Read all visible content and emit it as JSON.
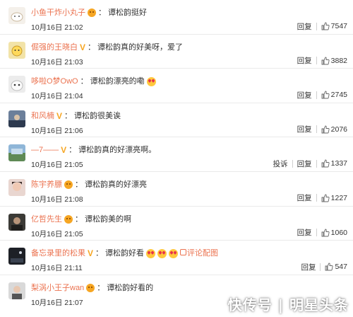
{
  "comments": [
    {
      "user": "小鱼干炸小丸子",
      "colon": "：",
      "text": "谭松韵挺好",
      "time": "10月16日 21:02",
      "reply": "回复",
      "likes": "7547"
    },
    {
      "user": "倔强的王晓白",
      "colon": "：",
      "text": "谭松韵真的好美呀，爱了",
      "time": "10月16日 21:03",
      "reply": "回复",
      "likes": "3882"
    },
    {
      "user": "哆啦O梦OwO",
      "colon": "：",
      "text": "谭松韵漂亮的嘞",
      "time": "10月16日 21:04",
      "reply": "回复",
      "likes": "2745"
    },
    {
      "user": "和风楠",
      "colon": "：",
      "text": "谭松韵很美诶",
      "time": "10月16日 21:06",
      "reply": "回复",
      "likes": "2076"
    },
    {
      "user": "—7——",
      "colon": "：",
      "text": "谭松韵真的好漂亮啊。",
      "time": "10月16日 21:05",
      "report": "投诉",
      "reply": "回复",
      "likes": "1337"
    },
    {
      "user": "陈宇养膘",
      "colon": "：",
      "text": "谭松韵真的好漂亮",
      "time": "10月16日 21:08",
      "reply": "回复",
      "likes": "1227"
    },
    {
      "user": "亿哲先生",
      "colon": "：",
      "text": "谭松韵美的啊",
      "time": "10月16日 21:05",
      "reply": "回复",
      "likes": "1060"
    },
    {
      "user": "备忘录里的松果",
      "colon": "：",
      "text": "谭松韵好看",
      "link": "评论配图",
      "time": "10月16日 21:11",
      "reply": "回复",
      "likes": "547"
    },
    {
      "user": "梨涡小王子wan",
      "colon": "：",
      "text": "谭松韵好看的",
      "time": "10月16日 21:07",
      "reply": "回复",
      "likes": ""
    }
  ],
  "watermark": "快传号 | 明星头条",
  "colors": {
    "username": "#eb7350",
    "text": "#333333",
    "badge": "#f6a623"
  }
}
